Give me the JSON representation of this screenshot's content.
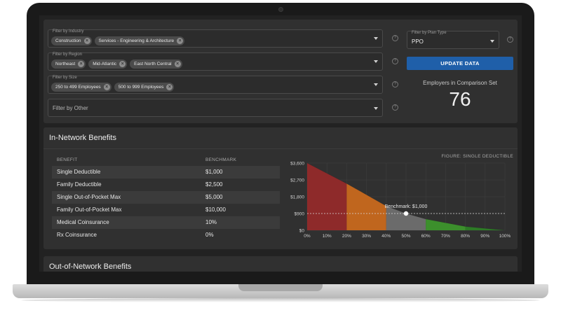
{
  "filters": {
    "industry": {
      "label": "Filter by Industry",
      "chips": [
        "Construction",
        "Services - Engineering & Architecture"
      ]
    },
    "region": {
      "label": "Filter by Region",
      "chips": [
        "Northeast",
        "Mid-Atlantic",
        "East North Central"
      ]
    },
    "size": {
      "label": "Filter by Size",
      "chips": [
        "250 to 499 Employees",
        "500 to 999 Employees"
      ]
    },
    "other": {
      "placeholder": "Filter by Other"
    },
    "help_glyph": "?",
    "chip_remove_glyph": "×"
  },
  "plan": {
    "label": "Filter by Plan Type",
    "value": "PPO"
  },
  "update_button": "UPDATE DATA",
  "comparison": {
    "label": "Employers in Comparison Set",
    "count": "76"
  },
  "in_network": {
    "title": "In-Network Benefits",
    "headers": {
      "benefit": "BENEFIT",
      "benchmark": "BENCHMARK"
    },
    "rows": [
      {
        "benefit": "Single Deductible",
        "benchmark": "$1,000"
      },
      {
        "benefit": "Family Deductible",
        "benchmark": "$2,500"
      },
      {
        "benefit": "Single Out-of-Pocket Max",
        "benchmark": "$5,000"
      },
      {
        "benefit": "Family Out-of-Pocket Max",
        "benchmark": "$10,000"
      },
      {
        "benefit": "Medical Coinsurance",
        "benchmark": "10%"
      },
      {
        "benefit": "Rx Coinsurance",
        "benchmark": "0%"
      }
    ]
  },
  "chart_data": {
    "type": "area",
    "title": "FIGURE: SINGLE DEDUCTIBLE",
    "x": [
      0,
      20,
      40,
      50,
      60,
      80,
      100
    ],
    "y": [
      3600,
      2500,
      1300,
      900,
      600,
      200,
      0
    ],
    "xticks": [
      "0%",
      "10%",
      "20%",
      "30%",
      "40%",
      "50%",
      "60%",
      "70%",
      "80%",
      "90%",
      "100%"
    ],
    "yticks": [
      "$3,600",
      "$2,700",
      "$1,800",
      "$900",
      "$0"
    ],
    "ytick_values": [
      3600,
      2700,
      1800,
      900,
      0
    ],
    "xlim": [
      0,
      100
    ],
    "ylim": [
      0,
      3600
    ],
    "bands": [
      {
        "from": 0,
        "to": 20,
        "color": "#8e2a2a"
      },
      {
        "from": 20,
        "to": 40,
        "color": "#c0661e"
      },
      {
        "from": 40,
        "to": 60,
        "color": "#6b6b6b"
      },
      {
        "from": 60,
        "to": 80,
        "color": "#3c8f2c"
      },
      {
        "from": 80,
        "to": 100,
        "color": "#2d7a26"
      }
    ],
    "benchmark": {
      "x": 50,
      "y": 900,
      "label": "Benchmark: $1,000"
    },
    "grid": true
  },
  "out_network": {
    "title": "Out-of-Network Benefits"
  }
}
